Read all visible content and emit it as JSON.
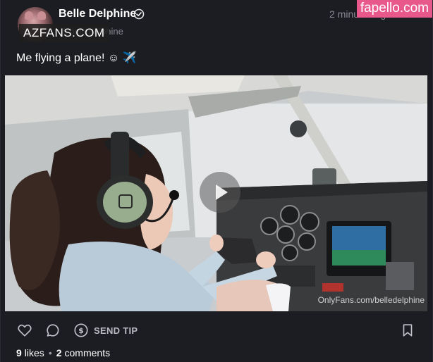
{
  "post": {
    "display_name": "Belle Delphine",
    "username": "@belledelphine",
    "timestamp": "2 minutes ago",
    "caption": "Me flying a plane! ☺ ✈️",
    "media_watermark": "OnlyFans.com/belledelphine"
  },
  "watermarks": {
    "left": "AZFANS.COM",
    "right": "fapello.com"
  },
  "actions": {
    "send_tip_label": "SEND TIP"
  },
  "stats": {
    "likes_count": "9",
    "likes_word": "likes",
    "comments_count": "2",
    "comments_word": "comments"
  },
  "colors": {
    "background": "#1c1d22",
    "muted_text": "#8a8b93",
    "accent_watermark": "#e8588a"
  },
  "icons": {
    "verified": "verified-badge-icon",
    "like": "heart-icon",
    "comment": "comment-bubble-icon",
    "tip": "dollar-circle-icon",
    "bookmark": "bookmark-icon",
    "play": "play-icon"
  }
}
